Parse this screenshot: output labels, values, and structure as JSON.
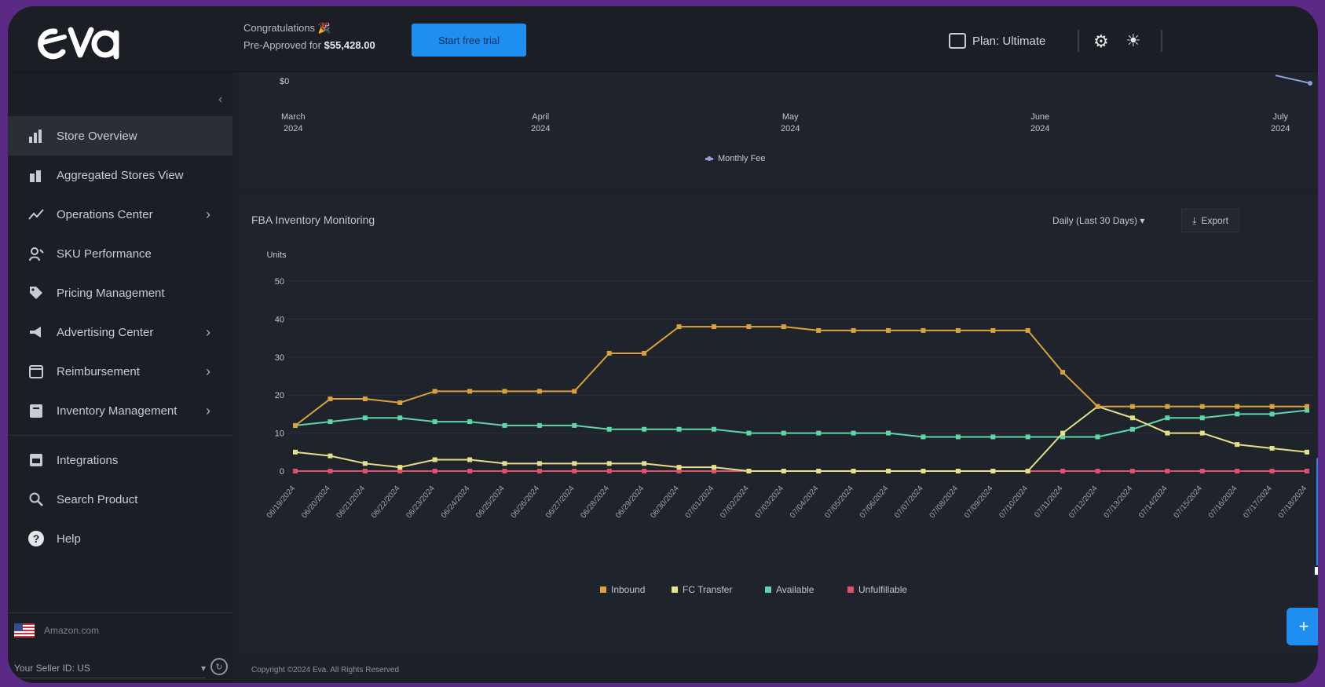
{
  "header": {
    "congrats_label": "Congratulations 🎉",
    "preapproved_label": "Pre-Approved for",
    "preapproved_amount": "$55,428.00",
    "cta_label": "Start free trial",
    "plan_label": "Plan: Ultimate"
  },
  "sidebar": {
    "items": [
      {
        "label": "Store Overview",
        "icon": "bar-chart-icon",
        "chevron": false,
        "active": true
      },
      {
        "label": "Aggregated Stores View",
        "icon": "stacked-bars-icon",
        "chevron": false,
        "active": false
      },
      {
        "label": "Operations Center",
        "icon": "trend-line-icon",
        "chevron": true,
        "active": false
      },
      {
        "label": "SKU Performance",
        "icon": "sku-performance-icon",
        "chevron": false,
        "active": false
      },
      {
        "label": "Pricing Management",
        "icon": "price-tag-icon",
        "chevron": false,
        "active": false
      },
      {
        "label": "Advertising Center",
        "icon": "megaphone-icon",
        "chevron": true,
        "active": false
      },
      {
        "label": "Reimbursement",
        "icon": "reimbursement-icon",
        "chevron": true,
        "active": false
      },
      {
        "label": "Inventory Management",
        "icon": "inventory-icon",
        "chevron": true,
        "active": false
      },
      {
        "label": "Integrations",
        "icon": "integrations-icon",
        "chevron": false,
        "active": false
      },
      {
        "label": "Search Product",
        "icon": "search-icon",
        "chevron": false,
        "active": false
      },
      {
        "label": "Help",
        "icon": "help-icon",
        "chevron": false,
        "active": false
      }
    ],
    "store_name": "Amazon.com",
    "seller_label": "Your Seller ID: US"
  },
  "top_panel": {
    "y_tick": "$0",
    "months": [
      {
        "m": "March",
        "y": "2024"
      },
      {
        "m": "April",
        "y": "2024"
      },
      {
        "m": "May",
        "y": "2024"
      },
      {
        "m": "June",
        "y": "2024"
      },
      {
        "m": "July",
        "y": "2024"
      }
    ],
    "legend": "Monthly Fee"
  },
  "inventory_panel": {
    "title": "FBA Inventory Monitoring",
    "period": "Daily (Last 30 Days)",
    "export_label": "Export"
  },
  "chart_data": {
    "type": "line",
    "title": "FBA Inventory Monitoring",
    "ylabel": "Units",
    "ylim": [
      0,
      50
    ],
    "yticks": [
      0,
      10,
      20,
      30,
      40,
      50
    ],
    "x": [
      "06/19/2024",
      "06/20/2024",
      "06/21/2024",
      "06/22/2024",
      "06/23/2024",
      "06/24/2024",
      "06/25/2024",
      "06/26/2024",
      "06/27/2024",
      "06/28/2024",
      "06/29/2024",
      "06/30/2024",
      "07/01/2024",
      "07/02/2024",
      "07/03/2024",
      "07/04/2024",
      "07/05/2024",
      "07/06/2024",
      "07/07/2024",
      "07/08/2024",
      "07/09/2024",
      "07/10/2024",
      "07/11/2024",
      "07/12/2024",
      "07/13/2024",
      "07/14/2024",
      "07/15/2024",
      "07/16/2024",
      "07/17/2024",
      "07/18/2024"
    ],
    "series": [
      {
        "name": "Inbound",
        "color": "#d9a23a",
        "values": [
          12,
          19,
          19,
          18,
          21,
          21,
          21,
          21,
          21,
          31,
          31,
          38,
          38,
          38,
          38,
          37,
          37,
          37,
          37,
          37,
          37,
          37,
          26,
          17,
          17,
          17,
          17,
          17,
          17,
          17
        ]
      },
      {
        "name": "FC Transfer",
        "color": "#e4e08a",
        "values": [
          5,
          4,
          2,
          1,
          3,
          3,
          2,
          2,
          2,
          2,
          2,
          1,
          1,
          0,
          0,
          0,
          0,
          0,
          0,
          0,
          0,
          0,
          10,
          17,
          14,
          10,
          10,
          7,
          6,
          5
        ]
      },
      {
        "name": "Available",
        "color": "#5fd6a8",
        "values": [
          12,
          13,
          14,
          14,
          13,
          13,
          12,
          12,
          12,
          11,
          11,
          11,
          11,
          10,
          10,
          10,
          10,
          10,
          9,
          9,
          9,
          9,
          9,
          9,
          11,
          14,
          14,
          15,
          15,
          16
        ]
      },
      {
        "name": "Unfulfillable",
        "color": "#e0506a",
        "values": [
          0,
          0,
          0,
          0,
          0,
          0,
          0,
          0,
          0,
          0,
          0,
          0,
          0,
          0,
          0,
          0,
          0,
          0,
          0,
          0,
          0,
          0,
          0,
          0,
          0,
          0,
          0,
          0,
          0,
          0
        ]
      }
    ]
  },
  "footer": "Copyright ©2024 Eva. All Rights Reserved"
}
